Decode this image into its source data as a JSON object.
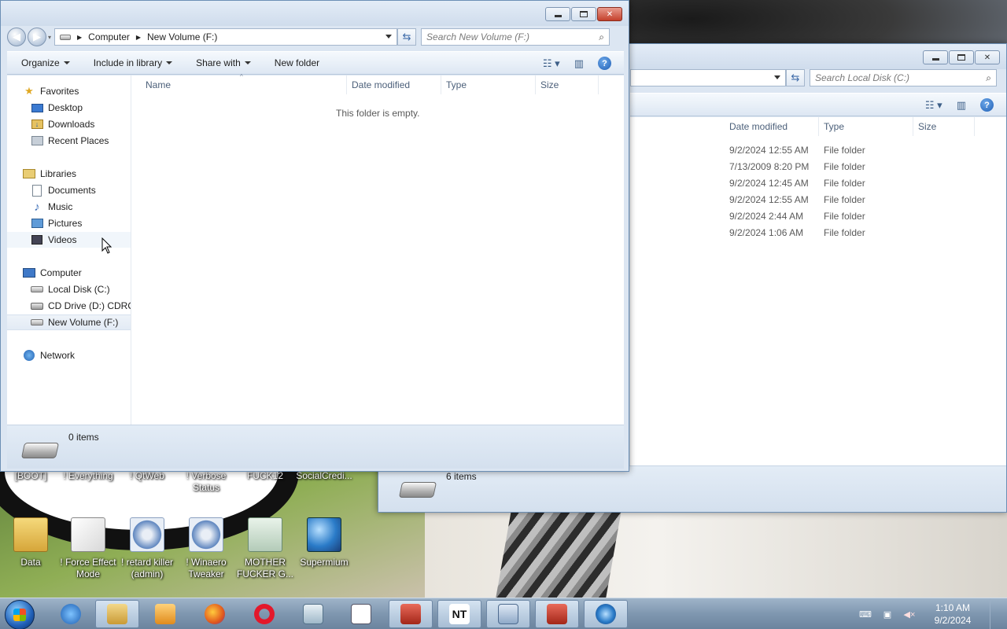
{
  "front_window": {
    "breadcrumb": [
      "Computer",
      "New Volume (F:)"
    ],
    "search_placeholder": "Search New Volume (F:)",
    "toolbar": {
      "organize": "Organize",
      "include_in_library": "Include in library",
      "share_with": "Share with",
      "new_folder": "New folder"
    },
    "columns": [
      "Name",
      "Date modified",
      "Type",
      "Size"
    ],
    "empty_message": "This folder is empty.",
    "status": "0 items",
    "nav": {
      "favorites": "Favorites",
      "desktop": "Desktop",
      "downloads": "Downloads",
      "recent_places": "Recent Places",
      "libraries": "Libraries",
      "documents": "Documents",
      "music": "Music",
      "pictures": "Pictures",
      "videos": "Videos",
      "computer": "Computer",
      "local_disk": "Local Disk (C:)",
      "cd_drive": "CD Drive (D:) CDROM",
      "new_volume": "New Volume (F:)",
      "network": "Network"
    }
  },
  "back_window": {
    "search_placeholder": "Search Local Disk (C:)",
    "columns": [
      "Date modified",
      "Type",
      "Size"
    ],
    "rows": [
      {
        "date": "9/2/2024 12:55 AM",
        "type": "File folder"
      },
      {
        "date": "7/13/2009 8:20 PM",
        "type": "File folder"
      },
      {
        "date": "9/2/2024 12:45 AM",
        "type": "File folder"
      },
      {
        "date": "9/2/2024 12:55 AM",
        "type": "File folder"
      },
      {
        "date": "9/2/2024 2:44 AM",
        "type": "File folder"
      },
      {
        "date": "9/2/2024 1:06 AM",
        "type": "File folder"
      }
    ],
    "status": "6 items"
  },
  "desktop": {
    "top_labels": [
      "[BOOT]",
      "! Everything",
      "! QtWeb",
      "! Verbose Status",
      "FUCK12",
      "SocialCredi..."
    ],
    "icons": [
      {
        "label": "Data",
        "icon": "folder-icon"
      },
      {
        "label": "! Force Effect Mode",
        "icon": "cube-icon"
      },
      {
        "label": "! retard killer (admin)",
        "icon": "gear-icon"
      },
      {
        "label": "! Winaero Tweaker",
        "icon": "gear-icon"
      },
      {
        "label": "MOTHER FUCKER G...",
        "icon": "document-icon"
      },
      {
        "label": "Supermium",
        "icon": "globe-icon"
      }
    ]
  },
  "taskbar": {
    "time": "1:10 AM",
    "date": "9/2/2024"
  },
  "colors": {
    "window_frame": "#dce6f2",
    "taskbar": "#7f97b0",
    "close_button": "#c4402c"
  }
}
